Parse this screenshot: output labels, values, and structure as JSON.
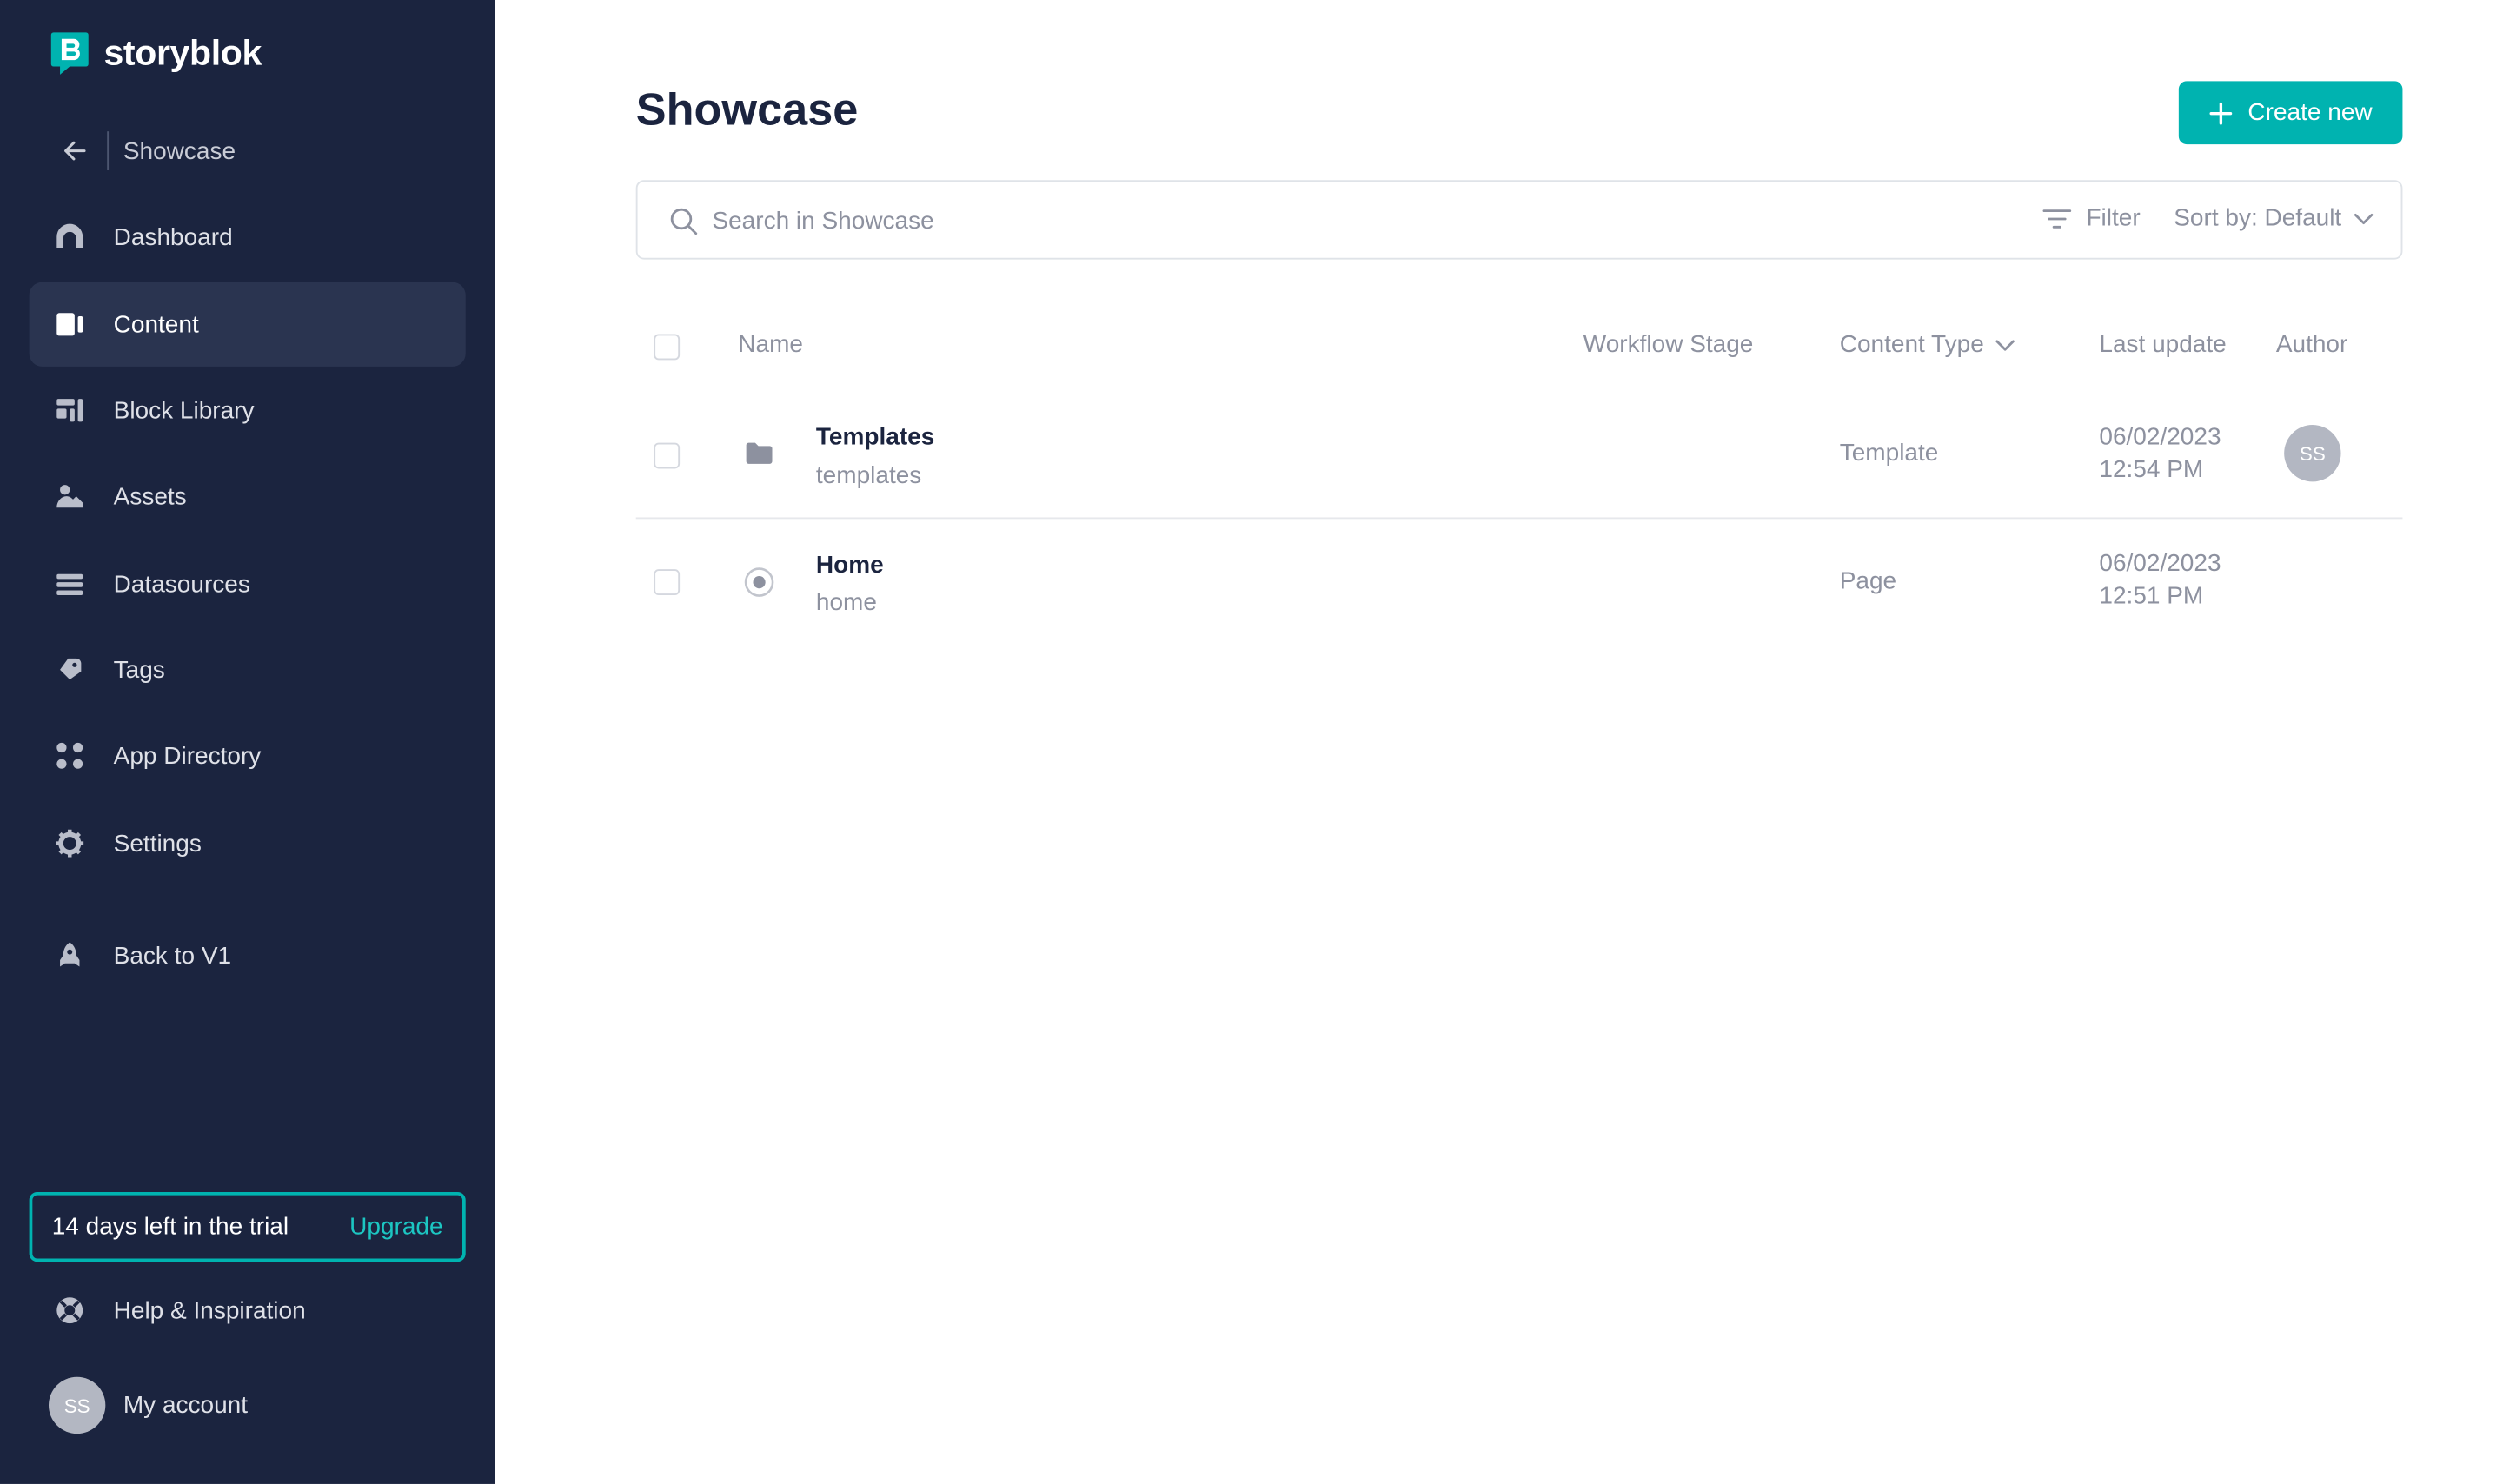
{
  "brand": {
    "name": "storyblok",
    "color": "#00b3b0"
  },
  "sidebar": {
    "back_label": "Showcase",
    "items": [
      {
        "label": "Dashboard",
        "icon": "dashboard-icon"
      },
      {
        "label": "Content",
        "icon": "content-icon",
        "active": true
      },
      {
        "label": "Block Library",
        "icon": "block-library-icon"
      },
      {
        "label": "Assets",
        "icon": "assets-icon"
      },
      {
        "label": "Datasources",
        "icon": "datasources-icon"
      },
      {
        "label": "Tags",
        "icon": "tag-icon"
      },
      {
        "label": "App Directory",
        "icon": "app-directory-icon"
      },
      {
        "label": "Settings",
        "icon": "gear-icon"
      },
      {
        "label": "Back to V1",
        "icon": "rocket-icon"
      }
    ],
    "trial": {
      "text": "14 days left in the trial",
      "upgrade": "Upgrade"
    },
    "help": "Help & Inspiration",
    "account": {
      "initials": "SS",
      "label": "My account"
    }
  },
  "main": {
    "title": "Showcase",
    "create_label": "Create new",
    "search_placeholder": "Search in Showcase",
    "filter_label": "Filter",
    "sort_label": "Sort by: Default",
    "columns": {
      "name": "Name",
      "workflow": "Workflow Stage",
      "content_type": "Content Type",
      "last_update": "Last update",
      "author": "Author"
    },
    "rows": [
      {
        "name": "Templates",
        "slug": "templates",
        "content_type": "Template",
        "date": "06/02/2023",
        "time": "12:54 PM",
        "author": "SS",
        "icon": "folder-icon"
      },
      {
        "name": "Home",
        "slug": "home",
        "content_type": "Page",
        "date": "06/02/2023",
        "time": "12:51 PM",
        "author": "",
        "icon": "story-icon"
      }
    ]
  }
}
